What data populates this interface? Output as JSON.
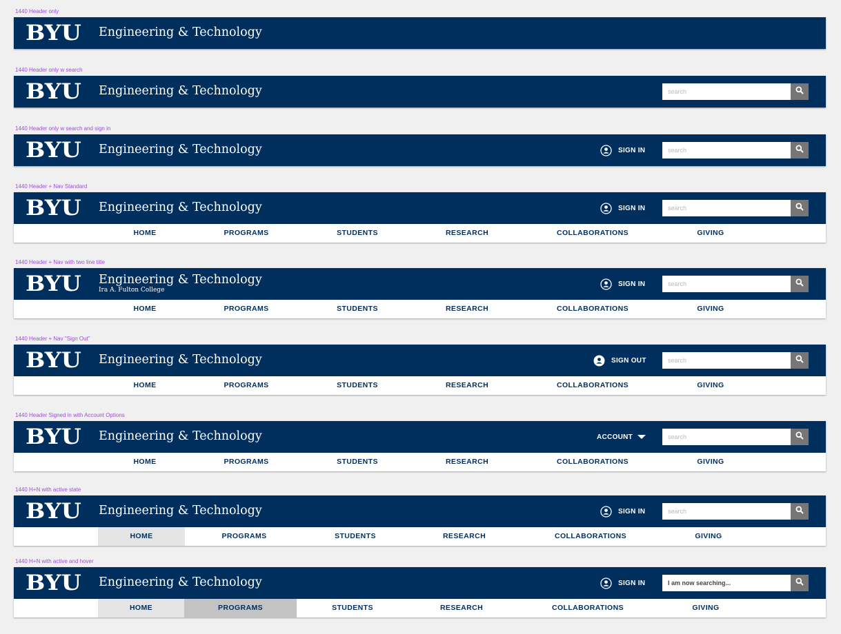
{
  "brand": {
    "logo": "BYU",
    "title": "Engineering & Technology",
    "subtitle": "Ira A. Fulton College"
  },
  "search": {
    "placeholder": "search",
    "typed_value": "I am now searching..."
  },
  "signin_label": "SIGN IN",
  "signout_label": "SIGN OUT",
  "account_label": "ACCOUNT",
  "nav_items": [
    "HOME",
    "PROGRAMS",
    "STUDENTS",
    "RESEARCH",
    "COLLABORATIONS",
    "GIVING"
  ],
  "variants": [
    {
      "label": "1440 Header only"
    },
    {
      "label": "1440 Header only w search"
    },
    {
      "label": "1440 Header only w search and sign in"
    },
    {
      "label": "1440 Header + Nav Standard"
    },
    {
      "label": "1440 Header + Nav with two line title"
    },
    {
      "label": "1440 Header + Nav \"Sign Out\""
    },
    {
      "label": "1440 Header Signed in with Account Options"
    },
    {
      "label": "1440 H+N with active state",
      "active_item": "HOME"
    },
    {
      "label": "1440 H+N with active and hover",
      "active_item": "HOME",
      "hover_item": "PROGRAMS"
    }
  ],
  "colors": {
    "header": "#002e5d",
    "nav_text": "#002e5d",
    "label": "#9b4fd0",
    "active": "#e4e4e4",
    "hover": "#c3c3c3",
    "search_button": "#767676"
  }
}
